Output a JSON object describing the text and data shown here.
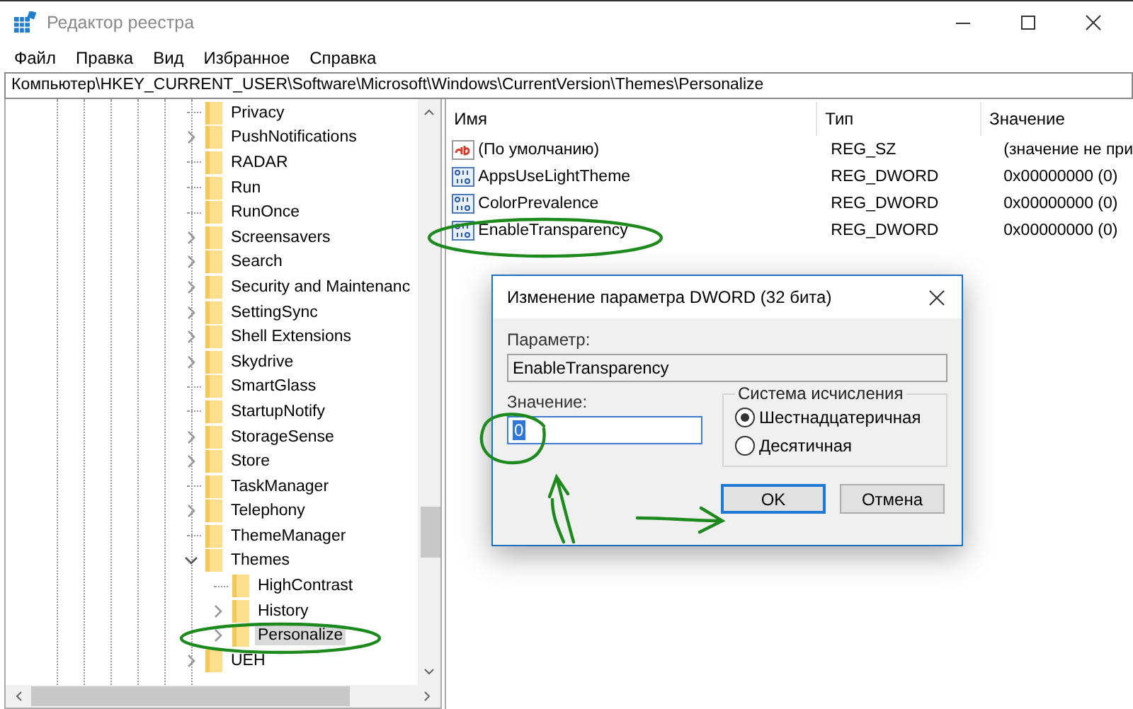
{
  "window": {
    "title": "Редактор реестра"
  },
  "menu": [
    "Файл",
    "Правка",
    "Вид",
    "Избранное",
    "Справка"
  ],
  "address": "Компьютер\\HKEY_CURRENT_USER\\Software\\Microsoft\\Windows\\CurrentVersion\\Themes\\Personalize",
  "tree": {
    "items": [
      {
        "label": "Privacy",
        "kind": "leaf",
        "selected": false
      },
      {
        "label": "PushNotifications",
        "kind": "collapsed",
        "selected": false
      },
      {
        "label": "RADAR",
        "kind": "leaf",
        "selected": false
      },
      {
        "label": "Run",
        "kind": "leaf",
        "selected": false
      },
      {
        "label": "RunOnce",
        "kind": "leaf",
        "selected": false
      },
      {
        "label": "Screensavers",
        "kind": "collapsed",
        "selected": false
      },
      {
        "label": "Search",
        "kind": "collapsed",
        "selected": false
      },
      {
        "label": "Security and Maintenanc",
        "kind": "collapsed",
        "selected": false
      },
      {
        "label": "SettingSync",
        "kind": "collapsed",
        "selected": false
      },
      {
        "label": "Shell Extensions",
        "kind": "collapsed",
        "selected": false
      },
      {
        "label": "Skydrive",
        "kind": "collapsed",
        "selected": false
      },
      {
        "label": "SmartGlass",
        "kind": "leaf",
        "selected": false
      },
      {
        "label": "StartupNotify",
        "kind": "leaf",
        "selected": false
      },
      {
        "label": "StorageSense",
        "kind": "collapsed",
        "selected": false
      },
      {
        "label": "Store",
        "kind": "collapsed",
        "selected": false
      },
      {
        "label": "TaskManager",
        "kind": "leaf",
        "selected": false
      },
      {
        "label": "Telephony",
        "kind": "collapsed",
        "selected": false
      },
      {
        "label": "ThemeManager",
        "kind": "leaf",
        "selected": false
      },
      {
        "label": "Themes",
        "kind": "expanded",
        "selected": false,
        "children": [
          {
            "label": "HighContrast",
            "kind": "leaf",
            "selected": false
          },
          {
            "label": "History",
            "kind": "collapsed",
            "selected": false
          },
          {
            "label": "Personalize",
            "kind": "collapsed",
            "selected": true
          }
        ]
      },
      {
        "label": "UEH",
        "kind": "collapsed",
        "selected": false
      }
    ]
  },
  "list": {
    "columns": [
      "Имя",
      "Тип",
      "Значение"
    ],
    "rows": [
      {
        "kind": "string",
        "name": "(По умолчанию)",
        "type": "REG_SZ",
        "value": "(значение не при"
      },
      {
        "kind": "dword",
        "name": "AppsUseLightTheme",
        "type": "REG_DWORD",
        "value": "0x00000000 (0)"
      },
      {
        "kind": "dword",
        "name": "ColorPrevalence",
        "type": "REG_DWORD",
        "value": "0x00000000 (0)"
      },
      {
        "kind": "dword",
        "name": "EnableTransparency",
        "type": "REG_DWORD",
        "value": "0x00000000 (0)"
      }
    ]
  },
  "dialog": {
    "title": "Изменение параметра DWORD (32 бита)",
    "param_label": "Параметр:",
    "param_value": "EnableTransparency",
    "value_label": "Значение:",
    "value": "0",
    "base_group": "Система исчисления",
    "bases": [
      {
        "label": "Шестнадцатеричная",
        "selected": true
      },
      {
        "label": "Десятичная",
        "selected": false
      }
    ],
    "buttons": [
      {
        "label": "OK",
        "default": true
      },
      {
        "label": "Отмена",
        "default": false
      }
    ]
  }
}
